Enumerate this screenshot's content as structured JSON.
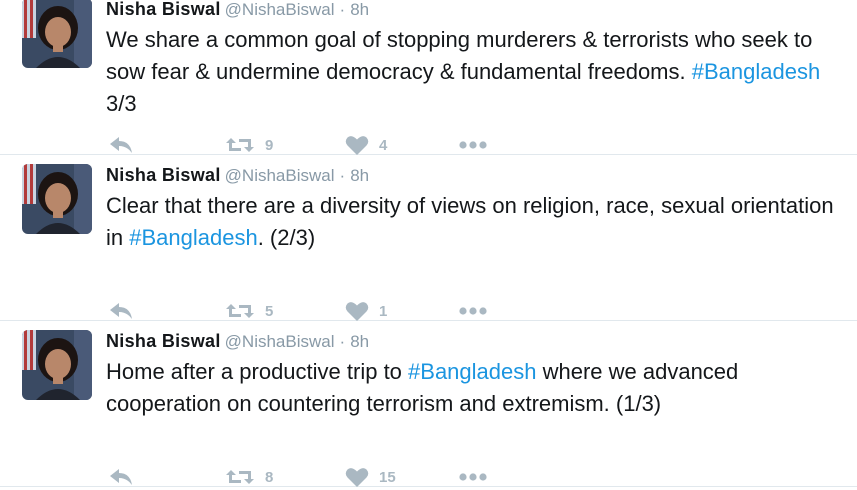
{
  "tweets": [
    {
      "name": "Nisha Biswal",
      "handle": "@NishaBiswal",
      "separator": "·",
      "time": "8h",
      "text_parts": [
        {
          "t": "We share a common goal of stopping murderers & terrorists who seek to sow fear & undermine democracy & fundamental freedoms. ",
          "tag": false
        },
        {
          "t": "#Bangladesh",
          "tag": true
        },
        {
          "t": " 3/3",
          "tag": false
        }
      ],
      "retweets": "9",
      "likes": "4"
    },
    {
      "name": "Nisha Biswal",
      "handle": "@NishaBiswal",
      "separator": "·",
      "time": "8h",
      "text_parts": [
        {
          "t": "Clear that there are a diversity of views on religion, race, sexual orientation in ",
          "tag": false
        },
        {
          "t": "#Bangladesh",
          "tag": true
        },
        {
          "t": ". (2/3)",
          "tag": false
        }
      ],
      "retweets": "5",
      "likes": "1"
    },
    {
      "name": "Nisha Biswal",
      "handle": "@NishaBiswal",
      "separator": "·",
      "time": "8h",
      "text_parts": [
        {
          "t": "Home after a productive trip to ",
          "tag": false
        },
        {
          "t": "#Bangladesh",
          "tag": true
        },
        {
          "t": " where we advanced cooperation on countering terrorism and extremism. (1/3)",
          "tag": false
        }
      ],
      "retweets": "8",
      "likes": "15"
    }
  ],
  "icons": {
    "reply": "reply-icon",
    "retweet": "retweet-icon",
    "like": "heart-icon",
    "more": "more-icon"
  },
  "colors": {
    "name": "#14171a",
    "meta": "#8899a6",
    "hashtag": "#1b95e0",
    "action": "#aab8c2",
    "divider": "#e1e8ed"
  }
}
